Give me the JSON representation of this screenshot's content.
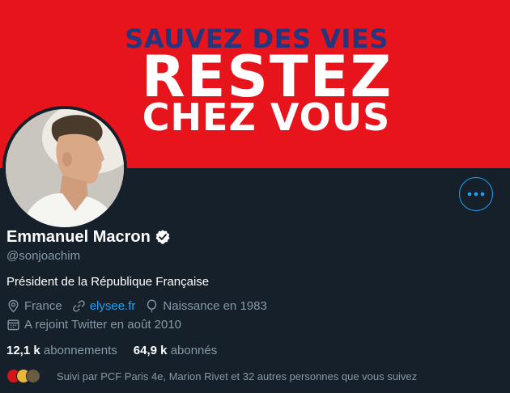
{
  "banner": {
    "line1": "SAUVEZ DES VIES",
    "line2": "RESTEZ",
    "line3": "CHEZ VOUS"
  },
  "profile": {
    "name": "Emmanuel Macron",
    "handle": "@sonjoachim",
    "bio": "Président de la République Française",
    "location": "France",
    "website": "elysee.fr",
    "birth": "Naissance en 1983",
    "joined": "A rejoint Twitter en août 2010"
  },
  "stats": {
    "following_count": "12,1 k",
    "following_label": "abonnements",
    "followers_count": "64,9 k",
    "followers_label": "abonnés"
  },
  "followed_by": "Suivi par PCF Paris 4e, Marion Rivet et 32 autres personnes que vous suivez",
  "colors": {
    "background": "#15202b",
    "banner": "#e8141c",
    "accent": "#1da1f2",
    "muted": "#8899a6"
  },
  "icons": [
    "more-icon",
    "verified-badge-icon",
    "location-icon",
    "link-icon",
    "balloon-icon",
    "calendar-icon"
  ]
}
